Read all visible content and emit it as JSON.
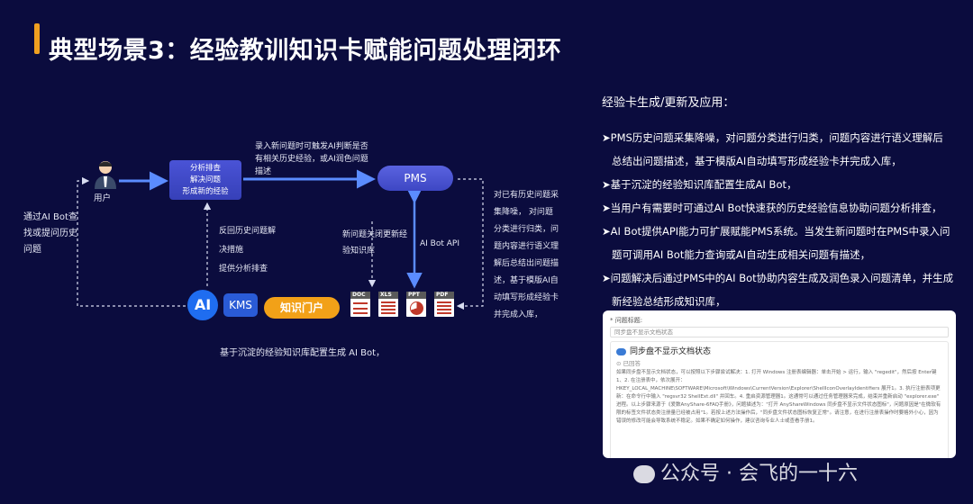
{
  "title": "典型场景3：经验教训知识卡赋能问题处理闭环",
  "diagram": {
    "left_note": [
      "通过AI Bot查",
      "找或提问历史",
      "问题"
    ],
    "user_label": "用户",
    "analysis_box": [
      "分析排查",
      "解决问题",
      "形成新的经验"
    ],
    "top_note": [
      "录入新问题时可触发AI判断是否",
      "有相关历史经验，或AI润色问题",
      "描述"
    ],
    "pms_label": "PMS",
    "middle_note": [
      "反回历史问题解",
      "决措施",
      "提供分析排查"
    ],
    "close_note": [
      "新问题关闭更新经",
      "验知识库"
    ],
    "api_label": "AI Bot API",
    "right_note": [
      "对已有历史问题采",
      "集降噪，  对问题",
      "分类进行归类，问",
      "题内容进行语义理",
      "解后总结出问题描",
      "述，基于模版AI自",
      "动填写形成经验卡",
      "并完成入库，"
    ],
    "ai_icon": "AI",
    "kms_icon": "KMS",
    "portal_label": "知识门户",
    "doc_labels": [
      "DOC",
      "XLS",
      "PPT",
      "PDF"
    ],
    "bottom_caption": "基于沉淀的经验知识库配置生成 AI Bot，"
  },
  "panel": {
    "heading": "经验卡生成/更新及应用：",
    "bullets": [
      [
        "➤PMS历史问题采集降噪，对问题分类进行归类，问题内容进行语义理解后",
        "总结出问题描述，基于模版AI自动填写形成经验卡并完成入库，"
      ],
      [
        "➤基于沉淀的经验知识库配置生成AI Bot，"
      ],
      [
        "➤当用户有需要时可通过AI Bot快速获的历史经验信息协助问题分析排查，"
      ],
      [
        "➤AI Bot提供API能力可扩展赋能PMS系统。当发生新问题时在PMS中录入问",
        "题可调用AI Bot能力查询或AI自动生成相关问题有描述，"
      ],
      [
        "➤问题解决后通过PMS中的AI Bot协助内容生成及润色录入问题清单，并生成",
        "新经验总结形成知识库，"
      ]
    ]
  },
  "card": {
    "field_label": "* 问题标题:",
    "field_value": "同步盘不显示文档状态",
    "result_title": "同步盘不显示文档状态",
    "answer_label": "已回答",
    "body": "如果同步盘不显示文档状态，可以按照以下步骤尝试解决：1. 打开 Windows 注册表编辑器：单击开始 > 运行，输入 \"regedit\"，然后按 Enter键 1、2. 在注册表中，依次展开：HKEY_LOCAL_MACHINE\\SOFTWARE\\Microsoft\\Windows\\CurrentVersion\\Explorer\\ShellIconOverlayIdentifiers 展开1。3. 执行注册表项更新：在命令行中输入 \"regsvr32 ShellExt.dll\" 并回车。4. 重启资源管理器1。这通常可以通过任务管理器来完成，结束并重新启动 \"explorer.exe\" 进程。以上步骤来源于《爱数AnyShare-6FAQ手册》，问题描述为：\"打开 AnyShareWindows 同步盘不显示文件状态图标\"，问题原因是\"在微软有限的标签文件状态类注册量已经被占用\"1。若按上述方法操作后，\"同步盘文件状态图标恢复正常\"。请注意，在进行注册表操作时要格外小心，因为错误的修改可能会导致系统不稳定。如果不确定如何操作，建议咨询专业人士或查看手册1。"
  },
  "watermark": "公众号 · 会飞的一十六",
  "colors": {
    "background": "#0b0c3e",
    "accent": "#f0a020",
    "box": "#4a53d6",
    "portal": "#f2a118"
  }
}
